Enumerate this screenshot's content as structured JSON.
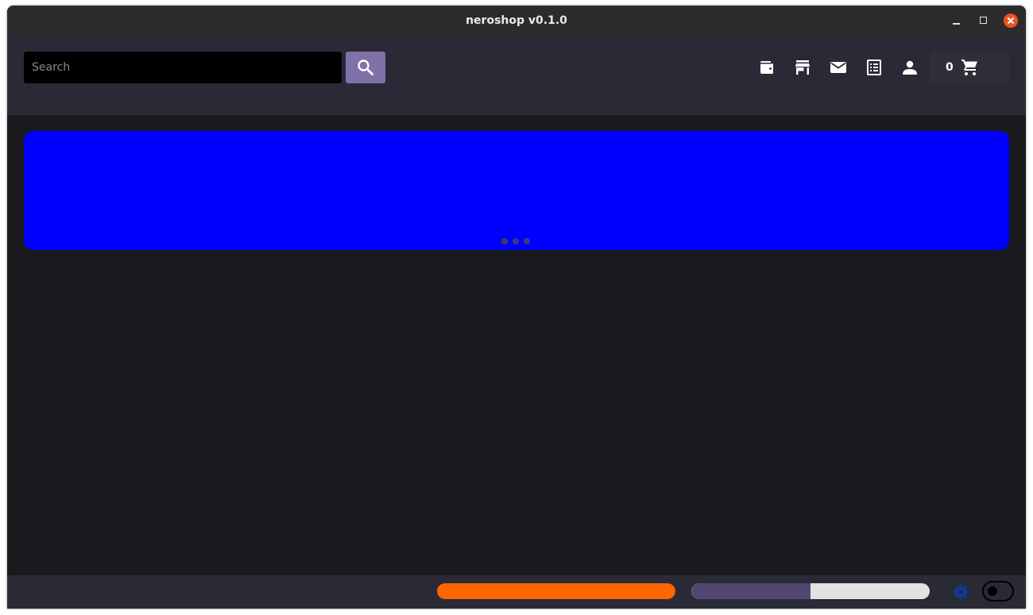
{
  "window": {
    "title": "neroshop v0.1.0",
    "controls": [
      "minimize",
      "maximize",
      "close"
    ]
  },
  "header": {
    "search": {
      "placeholder": "Search",
      "value": ""
    },
    "search_button_icon": "search-icon",
    "nav_icons": [
      "wallet-icon",
      "store-icon",
      "mail-icon",
      "orders-icon",
      "account-icon"
    ],
    "cart": {
      "count": "0",
      "icon": "cart-icon"
    }
  },
  "banner": {
    "color": "#0000ff",
    "slide_count": 3,
    "active_slide": 1
  },
  "footer": {
    "sync_progress": 1.0,
    "sync_color": "#ff6600",
    "status_progress": 0.5,
    "status_color": "#514772",
    "settings_icon": "gear-icon",
    "theme_toggle_on": false
  },
  "colors": {
    "background": "#1a1a1e",
    "header": "#2a2a36",
    "accent": "#8071a8",
    "close_button": "#e95420"
  }
}
